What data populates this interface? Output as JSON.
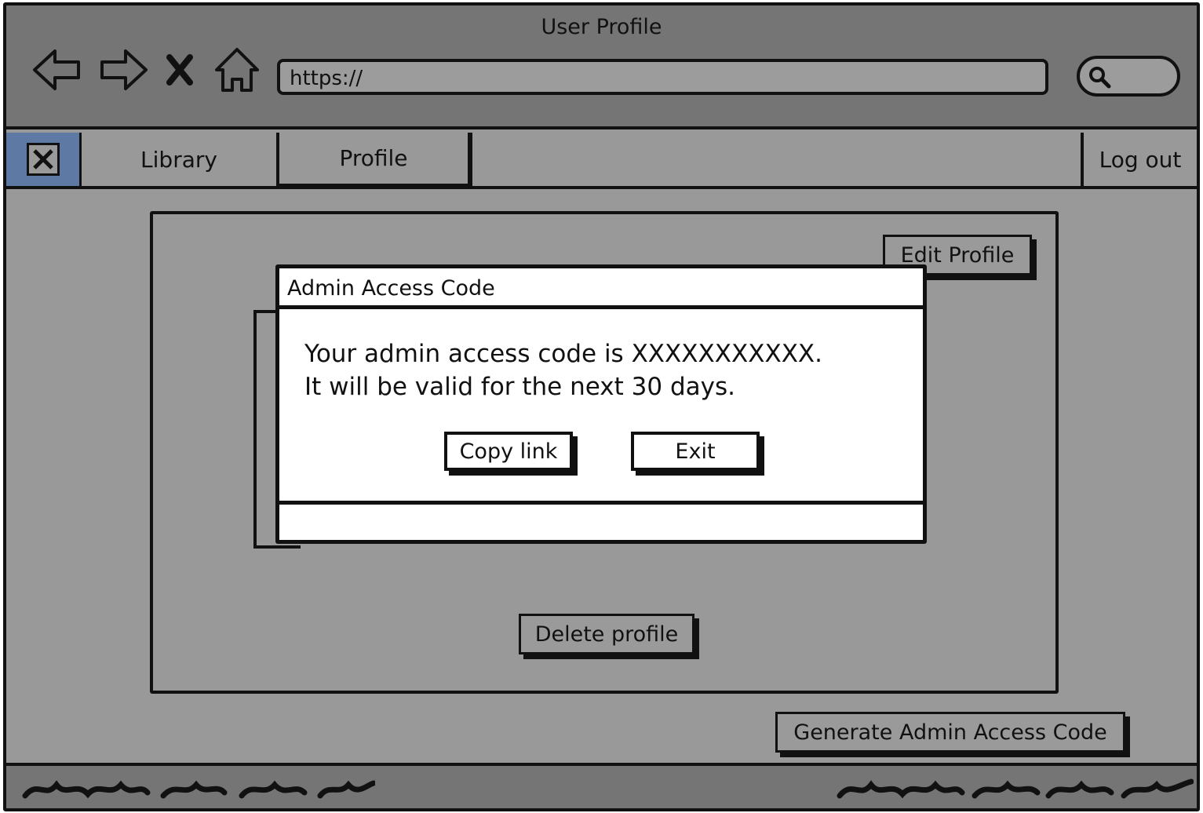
{
  "window": {
    "title": "User Profile"
  },
  "browser": {
    "url": "https://",
    "nav_icons": [
      "back-arrow-icon",
      "forward-arrow-icon",
      "stop-icon",
      "home-icon"
    ],
    "search_icon": "search-icon"
  },
  "tabs": {
    "library": "Library",
    "profile": "Profile",
    "logout": "Log out"
  },
  "profile_page": {
    "edit_label": "Edit Profile",
    "delete_label": "Delete profile",
    "generate_label": "Generate Admin Access Code"
  },
  "dialog": {
    "title": "Admin Access Code",
    "line1": "Your admin access code is XXXXXXXXXXX.",
    "line2": "It will be valid for the next 30 days.",
    "copy_label": "Copy link",
    "exit_label": "Exit"
  },
  "colors": {
    "chrome": "#757575",
    "background": "#999999",
    "close_tab": "#5e7aa4",
    "dialog": "#ffffff"
  }
}
